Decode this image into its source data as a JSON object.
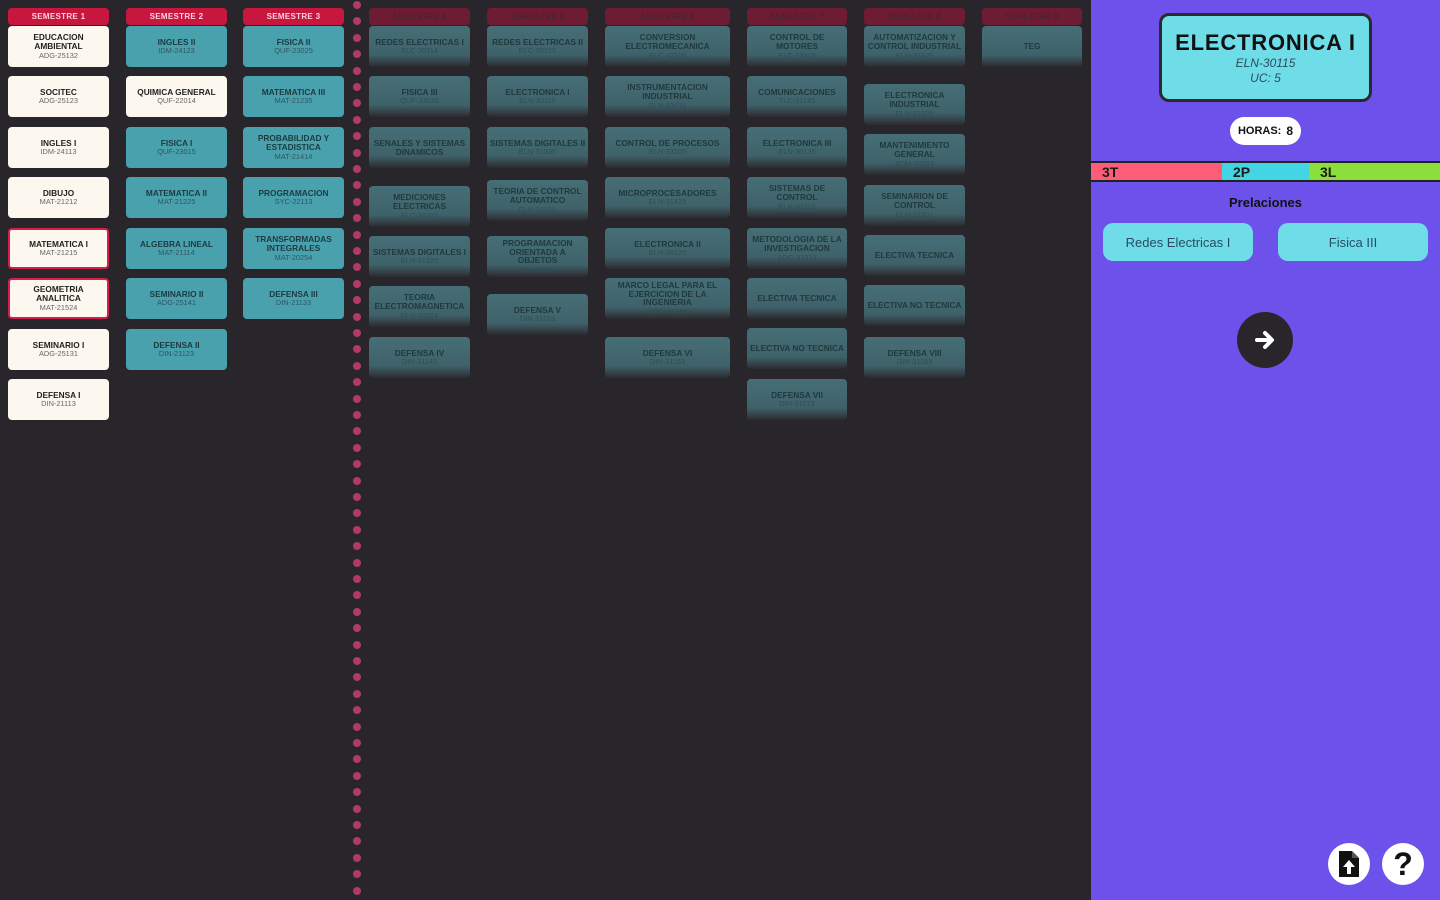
{
  "colors": {
    "background": "#28262a",
    "panel": "#6c52ea",
    "semester_header": "#c8173f",
    "approved_course": "#fcf8ef",
    "available_course": "#4aa1ae",
    "locked_course": "#466e76",
    "selected_border": "#d81e4a",
    "accent_cyan": "#6fdde7"
  },
  "semesters": [
    {
      "label": "SEMESTRE 1",
      "courses": [
        {
          "name": "EDUCACION AMBIENTAL",
          "code": "ADG-25132",
          "state": "approved"
        },
        {
          "name": "SOCITEC",
          "code": "ADG-25123",
          "state": "approved"
        },
        {
          "name": "INGLES I",
          "code": "IDM-24113",
          "state": "approved"
        },
        {
          "name": "DIBUJO",
          "code": "MAT-21212",
          "state": "approved"
        },
        {
          "name": "MATEMATICA I",
          "code": "MAT-21215",
          "state": "approved",
          "selected": true
        },
        {
          "name": "GEOMETRIA ANALITICA",
          "code": "MAT-21524",
          "state": "approved",
          "selected": true
        },
        {
          "name": "SEMINARIO I",
          "code": "ADG-25131",
          "state": "approved"
        },
        {
          "name": "DEFENSA I",
          "code": "DIN-21113",
          "state": "approved"
        }
      ]
    },
    {
      "label": "SEMESTRE 2",
      "courses": [
        {
          "name": "INGLES II",
          "code": "IDM-24123",
          "state": "available"
        },
        {
          "name": "QUIMICA GENERAL",
          "code": "QUF-22014",
          "state": "approved"
        },
        {
          "name": "FISICA I",
          "code": "QUF-23015",
          "state": "available"
        },
        {
          "name": "MATEMATICA II",
          "code": "MAT-21225",
          "state": "available"
        },
        {
          "name": "ALGEBRA LINEAL",
          "code": "MAT-21114",
          "state": "available"
        },
        {
          "name": "SEMINARIO II",
          "code": "ADG-25141",
          "state": "available"
        },
        {
          "name": "DEFENSA II",
          "code": "DIN-21123",
          "state": "available"
        }
      ]
    },
    {
      "label": "SEMESTRE 3",
      "courses": [
        {
          "name": "FISICA II",
          "code": "QUF-23025",
          "state": "available"
        },
        {
          "name": "MATEMATICA III",
          "code": "MAT-21235",
          "state": "available"
        },
        {
          "name": "PROBABILIDAD Y ESTADISTICA",
          "code": "MAT-21414",
          "state": "available"
        },
        {
          "name": "PROGRAMACION",
          "code": "SYC-22113",
          "state": "available"
        },
        {
          "name": "TRANSFORMADAS INTEGRALES",
          "code": "MAT-20254",
          "state": "available"
        },
        {
          "name": "DEFENSA III",
          "code": "DIN-21133",
          "state": "available"
        }
      ]
    },
    {
      "label": "SEMESTRE 4",
      "courses": [
        {
          "name": "REDES ELECTRICAS I",
          "code": "ELC-30114",
          "state": "locked"
        },
        {
          "name": "FISICA III",
          "code": "QUF-33035",
          "state": "locked"
        },
        {
          "name": "SENALES Y SISTEMAS DINAMICOS",
          "code": "",
          "state": "locked"
        },
        {
          "name": "MEDICIONES ELECTRICAS",
          "code": "ELC-30215",
          "state": "locked"
        },
        {
          "name": "SISTEMAS DIGITALES I",
          "code": "ELN-31325",
          "state": "locked"
        },
        {
          "name": "TEORIA ELECTROMAGNETICA",
          "code": "ELN-30314",
          "state": "locked"
        },
        {
          "name": "DEFENSA IV",
          "code": "DIN-31143",
          "state": "locked"
        }
      ]
    },
    {
      "label": "SEMESTRE 5",
      "courses": [
        {
          "name": "REDES ELECTRICAS II",
          "code": "ELC-30125",
          "state": "locked"
        },
        {
          "name": "ELECTRONICA I",
          "code": "ELN-30115",
          "state": "locked"
        },
        {
          "name": "SISTEMAS DIGITALES II",
          "code": "ELN-31335",
          "state": "locked"
        },
        {
          "name": "TEORIA DE CONTROL AUTOMATICO",
          "code": "ELN-33155",
          "state": "locked"
        },
        {
          "name": "PROGRAMACION ORIENTADA A OBJETOS",
          "code": "ELN-34013",
          "state": "locked"
        },
        {
          "name": "DEFENSA V",
          "code": "DIN-31153",
          "state": "locked"
        }
      ]
    },
    {
      "label": "SEMESTRE 6",
      "courses": [
        {
          "name": "CONVERSION ELECTROMECANICA",
          "code": "ELC-32105",
          "state": "locked"
        },
        {
          "name": "INSTRUMENTACION INDUSTRIAL",
          "code": "ELN-33415",
          "state": "locked"
        },
        {
          "name": "CONTROL DE PROCESOS",
          "code": "ELN-33205",
          "state": "locked"
        },
        {
          "name": "MICROPROCESADORES",
          "code": "ELN-31415",
          "state": "locked"
        },
        {
          "name": "ELECTRONICA II",
          "code": "ELN-30125",
          "state": "locked"
        },
        {
          "name": "MARCO LEGAL PARA EL EJERCICION DE LA INGENIERIA",
          "code": "ADG-31314",
          "state": "locked"
        },
        {
          "name": "DEFENSA VI",
          "code": "DIN-31163",
          "state": "locked"
        }
      ]
    },
    {
      "label": "SEMESTRE 7",
      "courses": [
        {
          "name": "CONTROL DE MOTORES",
          "code": "ELC-32415",
          "state": "locked"
        },
        {
          "name": "COMUNICACIONES",
          "code": "TLC-31145",
          "state": "locked"
        },
        {
          "name": "ELECTRONICA III",
          "code": "ELN-30135",
          "state": "locked"
        },
        {
          "name": "SISTEMAS DE CONTROL",
          "code": "ELN-33215",
          "state": "locked"
        },
        {
          "name": "METODOLOGIA DE LA INVESTIGACION",
          "code": "ADG-31314",
          "state": "locked"
        },
        {
          "name": "ELECTIVA TECNICA",
          "code": "",
          "state": "locked"
        },
        {
          "name": "ELECTIVA NO TECNICA",
          "code": "",
          "state": "locked"
        },
        {
          "name": "DEFENSA VII",
          "code": "DIN-31173",
          "state": "locked"
        }
      ]
    },
    {
      "label": "SEMESTRE 8",
      "courses": [
        {
          "name": "AUTOMATIZACION Y CONTROL INDUSTRIAL",
          "code": "ELN-33325",
          "state": "locked"
        },
        {
          "name": "ELECTRONICA INDUSTRIAL",
          "code": "ELN-31325",
          "state": "locked"
        },
        {
          "name": "MANTENIMIENTO GENERAL",
          "code": "ADM-30314",
          "state": "locked"
        },
        {
          "name": "SEMINARION DE CONTROL",
          "code": "ELN-33301",
          "state": "locked"
        },
        {
          "name": "ELECTIVA TECNICA",
          "code": "",
          "state": "locked"
        },
        {
          "name": "ELECTIVA NO TECNICA",
          "code": "",
          "state": "locked"
        },
        {
          "name": "DEFENSA VIII",
          "code": "DIN-31183",
          "state": "locked"
        }
      ]
    },
    {
      "label": "SEMESTRE 9",
      "courses": [
        {
          "name": "TEG",
          "code": "",
          "state": "locked"
        }
      ]
    }
  ],
  "detail": {
    "title": "ELECTRONICA I",
    "code": "ELN-30115",
    "uc": "UC: 5",
    "hours_label": "HORAS:",
    "hours_value": "8",
    "theory": "3T",
    "practice": "2P",
    "lab": "3L",
    "prereq_title": "Prelaciones",
    "prerequisites": [
      "Redes Electricas I",
      "Fisica III"
    ],
    "next_icon": "arrow-right-icon",
    "upload_icon": "file-upload-icon",
    "help_icon": "question-mark-icon"
  }
}
